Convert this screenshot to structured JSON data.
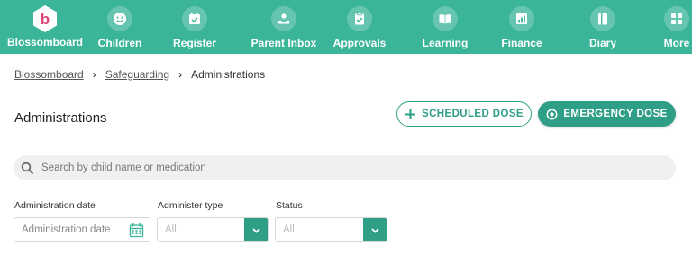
{
  "nav": {
    "brand": "Blossomboard",
    "items": [
      {
        "label": "Children",
        "icon": "smiley-icon"
      },
      {
        "label": "Register",
        "icon": "calendar-check-icon"
      },
      {
        "label": "Parent Inbox",
        "icon": "inbox-icon"
      },
      {
        "label": "Approvals",
        "icon": "clipboard-check-icon"
      },
      {
        "label": "Learning",
        "icon": "book-open-icon"
      },
      {
        "label": "Finance",
        "icon": "bar-chart-icon"
      },
      {
        "label": "Diary",
        "icon": "diary-icon"
      },
      {
        "label": "More",
        "icon": "grid-icon"
      }
    ],
    "color": "#3bb59a"
  },
  "breadcrumb": {
    "items": [
      "Blossomboard",
      "Safeguarding"
    ],
    "current": "Administrations",
    "separator": "›"
  },
  "page": {
    "title": "Administrations"
  },
  "actions": {
    "scheduled_dose": "SCHEDULED DOSE",
    "emergency_dose": "EMERGENCY DOSE",
    "accent": "#2e9e87"
  },
  "search": {
    "placeholder": "Search by child name or medication",
    "value": ""
  },
  "filters": {
    "administration_date": {
      "label": "Administration date",
      "placeholder": "Administration date"
    },
    "administer_type": {
      "label": "Administer type",
      "value": "All"
    },
    "status": {
      "label": "Status",
      "value": "All"
    }
  }
}
